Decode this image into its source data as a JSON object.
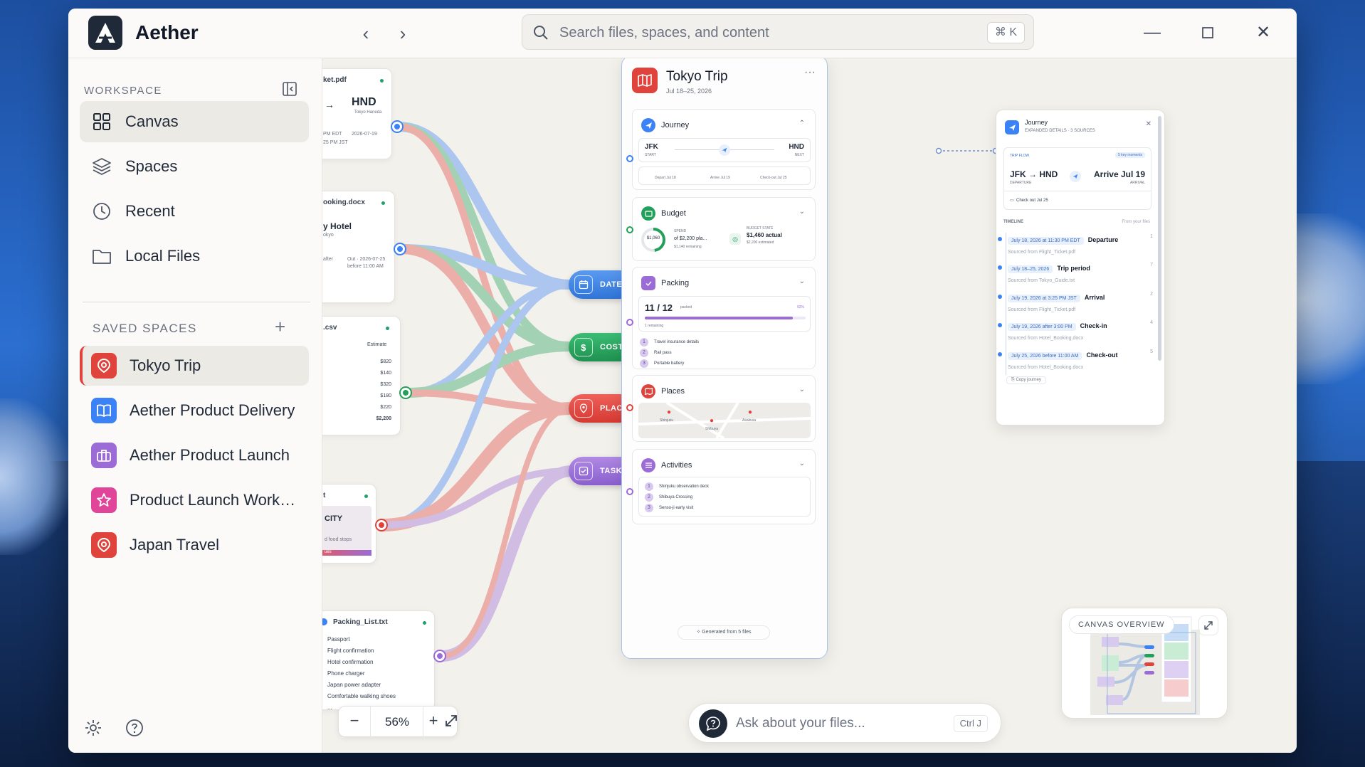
{
  "app": {
    "name": "Aether"
  },
  "search": {
    "placeholder": "Search files, spaces, and content",
    "shortcut": "⌘ K"
  },
  "sidebar": {
    "workspace_label": "WORKSPACE",
    "nav": [
      {
        "label": "Canvas",
        "icon": "grid-icon",
        "active": true
      },
      {
        "label": "Spaces",
        "icon": "layers-icon"
      },
      {
        "label": "Recent",
        "icon": "clock-icon"
      },
      {
        "label": "Local Files",
        "icon": "folder-icon"
      }
    ],
    "saved_label": "SAVED SPACES",
    "spaces": [
      {
        "label": "Tokyo Trip",
        "icon": "pin-icon",
        "color": "#e0433b",
        "active": true
      },
      {
        "label": "Aether Product Delivery",
        "icon": "book-icon",
        "color": "#3b82f6"
      },
      {
        "label": "Aether Product Launch",
        "icon": "briefcase-icon",
        "color": "#9b6bd6"
      },
      {
        "label": "Product Launch Works...",
        "icon": "star-icon",
        "color": "#e0459a"
      },
      {
        "label": "Japan Travel",
        "icon": "pin-icon",
        "color": "#e0433b"
      }
    ]
  },
  "files": {
    "flight": {
      "name": "ket.pdf",
      "to": "HND",
      "to_sub": "Tokyo Haneda",
      "l1": "PM EDT",
      "l1b": "2026-07-19",
      "l2": "25 PM JST"
    },
    "hotel": {
      "name": "ooking.docx",
      "title": "y Hotel",
      "sub": "okyo",
      "l1": "after",
      "out": "Out · 2026-07-25",
      "out2": "before 11:00 AM"
    },
    "budget": {
      "name": ".csv",
      "col": "Estimate",
      "rows": [
        "$820",
        "$140",
        "$320",
        "$180",
        "$220"
      ],
      "total": "$2,200"
    },
    "guide": {
      "name": "t",
      "title": "CITY",
      "sub": "d food stops",
      "tag": "ues"
    },
    "packing": {
      "name": "Packing_List.txt",
      "items": [
        "Passport",
        "Flight confirmation",
        "Hotel confirmation",
        "Phone charger",
        "Japan power adapter",
        "Comfortable walking shoes",
        "..."
      ]
    }
  },
  "hubs": [
    {
      "label": "DATES",
      "color": "#3b82f6",
      "icon": "calendar-icon"
    },
    {
      "label": "COST",
      "color": "#22a05a",
      "icon": "dollar-icon"
    },
    {
      "label": "PLACE",
      "color": "#e0433b",
      "icon": "pin-icon"
    },
    {
      "label": "TASKS",
      "color": "#9b6bd6",
      "icon": "checkbox-icon"
    }
  ],
  "trip": {
    "title": "Tokyo Trip",
    "dates": "Jul 18–25, 2026",
    "journey": {
      "title": "Journey",
      "from": "JFK",
      "from_sub": "START",
      "to": "HND",
      "to_sub": "NEXT",
      "steps": [
        "Depart Jul 18",
        "Arrive Jul 19",
        "Check-out Jul 25"
      ]
    },
    "budget": {
      "title": "Budget",
      "ring": "$1,060",
      "spend_label": "SPEND",
      "spend": "of $2,200 pla...",
      "remaining": "$1,140 remaining",
      "state_label": "BUDGET STATE",
      "actual": "$1,460 actual",
      "estimated": "$2,200 estimated",
      "progress": 0.48
    },
    "packing": {
      "title": "Packing",
      "count": "11 / 12",
      "count_sub": "packed",
      "pct": "92%",
      "remaining": "1 remaining",
      "progress": 0.92,
      "items": [
        "Travel insurance details",
        "Rail pass",
        "Portable battery"
      ]
    },
    "places": {
      "title": "Places",
      "pins": [
        "Shinjuku",
        "Shibuya",
        "Asakusa"
      ]
    },
    "activities": {
      "title": "Activities",
      "items": [
        "Shinjuku observation deck",
        "Shibuya Crossing",
        "Senso-ji early visit"
      ]
    },
    "generated": "Generated from 5 files"
  },
  "expanded": {
    "title": "Journey",
    "subtitle": "EXPANDED DETAILS · 3 SOURCES",
    "flow_label": "TRIP FLOW",
    "flow_badge": "5 key moments",
    "route": "JFK → HND",
    "route_sub": "DEPARTURE",
    "arrive": "Arrive Jul 19",
    "arrive_sub": "ARRIVAL",
    "checkout": "Check out Jul 25",
    "timeline_label": "TIMELINE",
    "timeline_from": "From your files",
    "timeline": [
      {
        "date": "July 18, 2026 at 11:30 PM EDT",
        "title": "Departure",
        "src": "Sourced from Flight_Ticket.pdf",
        "n": "1"
      },
      {
        "date": "July 18–25, 2026",
        "title": "Trip period",
        "src": "Sourced from Tokyo_Guide.txt",
        "n": "7"
      },
      {
        "date": "July 19, 2026 at 3:25 PM JST",
        "title": "Arrival",
        "src": "Sourced from Flight_Ticket.pdf",
        "n": "2"
      },
      {
        "date": "July 19, 2026 after 3:00 PM",
        "title": "Check-in",
        "src": "Sourced from Hotel_Booking.docx",
        "n": "4"
      },
      {
        "date": "July 25, 2026 before 11:00 AM",
        "title": "Check-out",
        "src": "Sourced from Hotel_Booking.docx",
        "n": "5"
      }
    ],
    "copy": "Copy journey"
  },
  "zoom": {
    "value": "56%"
  },
  "ask": {
    "placeholder": "Ask about your files...",
    "shortcut": "Ctrl J"
  },
  "overview": {
    "label": "CANVAS OVERVIEW"
  }
}
